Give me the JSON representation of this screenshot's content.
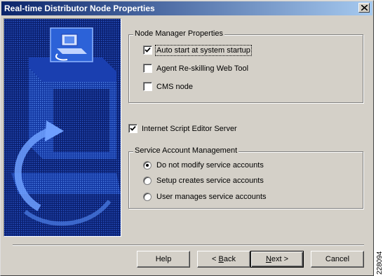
{
  "window": {
    "title": "Real-time Distributor Node Properties"
  },
  "node_manager": {
    "group_label": "Node Manager Properties",
    "auto_start": {
      "label": "Auto start at system startup",
      "checked": true
    },
    "agent_reskilling": {
      "label": "Agent Re-skilling Web Tool",
      "checked": false
    },
    "cms_node": {
      "label": "CMS node",
      "checked": false
    }
  },
  "internet_script": {
    "label": "Internet Script Editor Server",
    "checked": true
  },
  "service_account": {
    "group_label": "Service Account Management",
    "options": [
      {
        "label": "Do not modify service accounts",
        "selected": true
      },
      {
        "label": "Setup creates service accounts",
        "selected": false
      },
      {
        "label": "User manages service accounts",
        "selected": false
      }
    ]
  },
  "buttons": {
    "help": "Help",
    "back_prefix": "< ",
    "back_key": "B",
    "back_rest": "ack",
    "next_key": "N",
    "next_rest": "ext >",
    "cancel": "Cancel"
  },
  "figure_id": "228094"
}
